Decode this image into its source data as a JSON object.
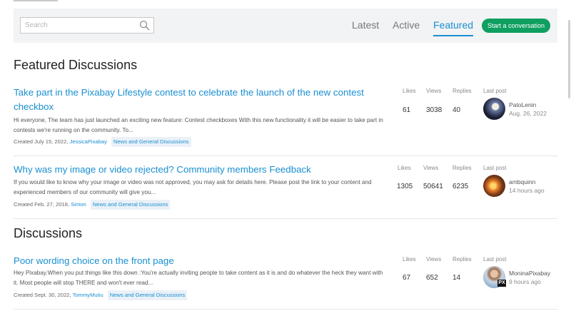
{
  "search": {
    "placeholder": "Search"
  },
  "tabs": [
    {
      "label": "Latest"
    },
    {
      "label": "Active"
    },
    {
      "label": "Featured"
    }
  ],
  "start_button": "Start a conversation",
  "stat_labels": {
    "likes": "Likes",
    "views": "Views",
    "replies": "Replies",
    "last_post": "Last post"
  },
  "featured": {
    "heading": "Featured Discussions",
    "items": [
      {
        "title": "Take part in the Pixabay Lifestyle contest to celebrate the launch of the new contest checkbox",
        "excerpt": "Hi everyone, The team has just launched an exciting new feature: Contest checkboxes With this new functionality it will be easier to take part in contests we're running on the community. To...",
        "created": "Created July 15, 2022,",
        "author": "JessicaPixabay",
        "category": "News and General Discussions",
        "likes": "61",
        "views": "3038",
        "replies": "40",
        "last_user": "PatoLenin",
        "last_time": "Aug. 26, 2022"
      },
      {
        "title": "Why was my image or video rejected? Community members Feedback",
        "excerpt": "If you would like to know why your image or video was not approved, you may ask for details here. Please post the link to your content and experienced members of our community will give you...",
        "created": "Created Feb. 27, 2018,",
        "author": "Simon",
        "category": "News and General Discussions",
        "likes": "1305",
        "views": "50641",
        "replies": "6235",
        "last_user": "ambquinn",
        "last_time": "14 hours ago"
      }
    ]
  },
  "discussions": {
    "heading": "Discussions",
    "items": [
      {
        "title": "Poor wording choice on the front page",
        "excerpt": "Hey Pixabay.When you put things like this down :You're actually inviting people to take content as it is and do whatever the heck they want with it. Most people will stop THERE and won't ever read...",
        "created": "Created Sept. 30, 2022,",
        "author": "TommyMutiu",
        "category": "News and General Discussions",
        "likes": "67",
        "views": "652",
        "replies": "14",
        "last_user": "MoninaPixabay",
        "last_time": "9 hours ago",
        "badge": "PX"
      }
    ]
  }
}
